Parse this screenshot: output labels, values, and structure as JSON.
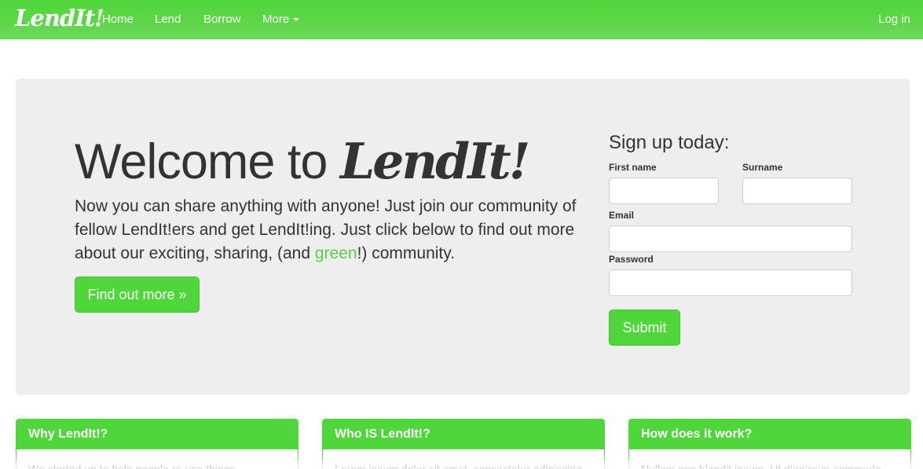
{
  "navbar": {
    "brand": "LendIt!",
    "items": [
      {
        "label": "Home"
      },
      {
        "label": "Lend"
      },
      {
        "label": "Borrow"
      },
      {
        "label": "More"
      }
    ],
    "login_label": "Log in"
  },
  "hero": {
    "title_prefix": "Welcome to ",
    "title_brand": "LendIt!",
    "lead_part1": "Now you can share anything with anyone! Just join our community of fellow LendIt!ers and get LendIt!ing. Just click below to find out more about our exciting, sharing, (and ",
    "lead_green": "green",
    "lead_part2": "!) community.",
    "button_label": "Find out more »"
  },
  "signup": {
    "title": "Sign up today:",
    "first_name_label": "First name",
    "surname_label": "Surname",
    "email_label": "Email",
    "password_label": "Password",
    "submit_label": "Submit"
  },
  "panels": [
    {
      "heading": "Why LendIt!?",
      "body": "We started up to help people re-use things"
    },
    {
      "heading": "Who IS LendIt!?",
      "body": "Lorem ipsum dolor sit amet, consectetur adipiscing"
    },
    {
      "heading": "How does it work?",
      "body": "Nullam nec blandit ipsum. Ut dignissim commodo"
    }
  ],
  "colors": {
    "brand_green": "#4fd63a",
    "accent_green_text": "#5cc94c",
    "jumbotron_bg": "#eeeeee"
  }
}
